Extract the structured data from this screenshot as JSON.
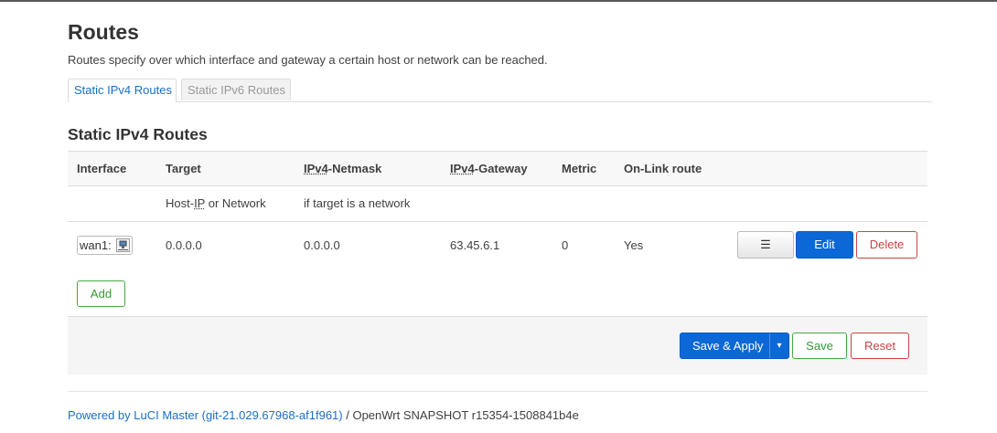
{
  "page": {
    "title": "Routes",
    "description": "Routes specify over which interface and gateway a certain host or network can be reached."
  },
  "tabs": [
    {
      "label": "Static IPv4 Routes",
      "active": true
    },
    {
      "label": "Static IPv6 Routes",
      "active": false
    }
  ],
  "section": {
    "title": "Static IPv4 Routes"
  },
  "table": {
    "headers": {
      "interface": "Interface",
      "target": "Target",
      "netmask_abbr": "IPv4",
      "netmask_rest": "-Netmask",
      "gateway_abbr": "IPv4",
      "gateway_rest": "-Gateway",
      "metric": "Metric",
      "onlink": "On-Link route"
    },
    "descriptions": {
      "target_pre": "Host-",
      "target_abbr": "IP",
      "target_post": " or Network",
      "netmask": "if target is a network"
    },
    "rows": [
      {
        "interface": "wan1:",
        "interface_icon": "network-port-icon",
        "target": "0.0.0.0",
        "netmask": "0.0.0.0",
        "gateway": "63.45.6.1",
        "metric": "0",
        "onlink": "Yes",
        "more_label": "☰",
        "edit_label": "Edit",
        "delete_label": "Delete"
      }
    ],
    "add_label": "Add"
  },
  "actions": {
    "save_apply_label": "Save & Apply",
    "dropdown_glyph": "▾",
    "save_label": "Save",
    "reset_label": "Reset"
  },
  "footer": {
    "link_text": "Powered by LuCI Master (git-21.029.67968-af1f961)",
    "rest_text": " / OpenWrt SNAPSHOT r15354-1508841b4e"
  },
  "colors": {
    "primary": "#0c68d6",
    "positive": "#393",
    "negative": "#c44",
    "link": "#1a6fc4"
  }
}
